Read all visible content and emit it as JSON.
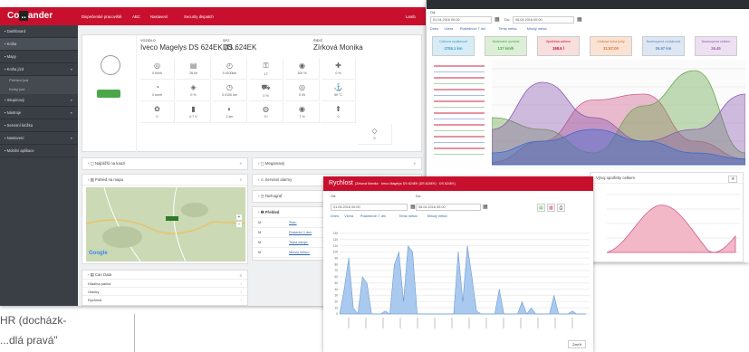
{
  "main": {
    "logo": {
      "pre": "Co",
      "accent": "..",
      "post": "ander",
      "tagline": ""
    },
    "nav": [
      "Dispečerské pracoviště",
      "ABC",
      "Nastavení",
      "Security dispatch"
    ],
    "nav_right": "Lamb",
    "sidebar": [
      {
        "label": "Dashboard",
        "icon": "dashboard-icon"
      },
      {
        "label": "Kniha",
        "icon": "book-icon",
        "active": true
      },
      {
        "label": "Mapy",
        "icon": "map-icon"
      },
      {
        "label": "Kniha jízd",
        "icon": "route-icon",
        "caret": true
      },
      {
        "label": "Přehled jízd",
        "sub": true
      },
      {
        "label": "Knihy jízd",
        "sub": true
      },
      {
        "label": "Skupinový",
        "icon": "group-icon",
        "caret": true
      },
      {
        "label": "Nástroje",
        "icon": "tools-icon",
        "caret": true
      },
      {
        "label": "Servisní knížka",
        "icon": "service-icon"
      },
      {
        "label": "Nastavení",
        "icon": "settings-icon",
        "caret": true
      },
      {
        "label": "Mobilní aplikace",
        "icon": "mobile-icon"
      }
    ],
    "vehicle": {
      "vehicle_label": "VOZIDLO",
      "vehicle_value": "Iveco Magelys DS 624EK (D...",
      "spz_label": "SPZ",
      "spz_value": "DS 624EK",
      "driver_label": "ŘIDIČ",
      "driver_value": "Zírková Monika",
      "cells": [
        {
          "icon": "◎",
          "v": "0 km/h"
        },
        {
          "icon": "▤",
          "v": "26 l/h"
        },
        {
          "icon": "◴",
          "v": "0 l/100km"
        },
        {
          "icon": "⚿",
          "v": "17"
        },
        {
          "icon": "◉",
          "v": "100 %"
        },
        {
          "icon": "✚",
          "v": "0 %"
        },
        {
          "icon": "◔",
          "v": "0 km/h"
        },
        {
          "icon": "◈",
          "v": "0 %"
        },
        {
          "icon": "◷",
          "v": "0 l/100 km"
        },
        {
          "icon": "⛟",
          "v": "0 %"
        },
        {
          "icon": "◎",
          "v": "0 l/h"
        },
        {
          "icon": "⚓",
          "v": "59 °C"
        },
        {
          "icon": "✿",
          "v": "0"
        },
        {
          "icon": "▮",
          "v": "0.7 V"
        },
        {
          "icon": "◐",
          "v": "1 km"
        },
        {
          "icon": "◍",
          "v": "0 l"
        },
        {
          "icon": "◉",
          "v": "7 %"
        },
        {
          "icon": "⬆",
          "v": "0"
        }
      ],
      "extra_icon": "◇",
      "extra_val": "0"
    },
    "panels": {
      "nearest": "Najbližší na kauzi",
      "megamap": "Megamaný",
      "map_panel": "Pohled na mapu",
      "alarms": "Servisní alarmy",
      "tacho": "Tachograf",
      "overview": "Přehled",
      "can": "Can Data"
    },
    "overview_rows": [
      {
        "a": "M",
        "b": "Stav:",
        "c": "38.7 km"
      },
      {
        "a": "M",
        "b": "Poslední 1 den",
        "c": "510.1 km"
      },
      {
        "a": "M",
        "b": "Teplá zdroje:",
        "c": "126.9 km"
      },
      {
        "a": "M",
        "b": "Minulý měsíc:",
        "c": "2750.1 km"
      }
    ],
    "can_rows": [
      "Hladina paliva",
      "Otáčky",
      "Rychlost"
    ],
    "map_google": "Google"
  },
  "win2": {
    "from_label": "Od:",
    "from_value": "01.04.2016 00:00",
    "to_label": "Do:",
    "to_value": "08.04.2016 00:00",
    "links": [
      "Dnes",
      "Včera",
      "Posledních 7 dní",
      "Tento měsíc",
      "Minulý měsíc"
    ],
    "stats": [
      {
        "label": "Celková vzdálenost",
        "value": "2755.1 km",
        "color": "#3a9bd0",
        "bg": "#d7ecf6"
      },
      {
        "label": "Maximální rychlost",
        "value": "137 km/h",
        "color": "#4aa84a",
        "bg": "#dcefd6"
      },
      {
        "label": "Spotřeba celkem",
        "value": "198.6 l",
        "color": "#c8102e",
        "bg": "#f9dede"
      },
      {
        "label": "Celková doba jízdy",
        "value": "31:57:00",
        "color": "#e06a2a",
        "bg": "#fbe3d4"
      },
      {
        "label": "Nastoupená vzdálenost",
        "value": "26.97 km",
        "color": "#5a8ac8",
        "bg": "#dde6f3"
      },
      {
        "label": "Nastoupená celkem",
        "value": "26.45",
        "color": "#9a5ab0",
        "bg": "#ece0f1"
      }
    ],
    "panel_title": "Vývoj spotřeby celkem",
    "chart_data": {
      "type": "area",
      "series": [
        {
          "color": "#d05a8a",
          "values": [
            2,
            20,
            55,
            60,
            20,
            5
          ]
        },
        {
          "color": "#6aa84a",
          "values": [
            40,
            30,
            10,
            50,
            80,
            10
          ]
        },
        {
          "color": "#8a5ab0",
          "values": [
            30,
            70,
            40,
            20,
            30,
            60
          ]
        },
        {
          "color": "#3a6ad0",
          "values": [
            10,
            20,
            30,
            20,
            10,
            5
          ]
        }
      ]
    }
  },
  "win3": {
    "title": "Rychlost",
    "subtitle": "(Zírková Monika · Iveco Magelys DS 624EK (DS 624EK) · DS 624EK)",
    "from_label": "Od:",
    "from_value": "01.04.2016 00:00",
    "to_label": "Do:",
    "to_value": "08.04.2016 00:00",
    "links": [
      "Dnes",
      "Včera",
      "Posledních 7 dní",
      "Tento měsíc",
      "Minulý měsíc"
    ],
    "close_label": "Zavřít",
    "chart_data": {
      "type": "area",
      "ylim": [
        0,
        140
      ],
      "yticks": [
        0,
        10,
        20,
        30,
        40,
        50,
        60,
        70,
        80,
        90,
        100,
        110,
        120,
        130
      ],
      "values": [
        0,
        40,
        90,
        10,
        0,
        60,
        50,
        0,
        0,
        0,
        5,
        0,
        80,
        100,
        20,
        110,
        100,
        0,
        0,
        0,
        0,
        0,
        0,
        0,
        0,
        0,
        100,
        20,
        110,
        60,
        5,
        0,
        0,
        0,
        0,
        40,
        0,
        0,
        0,
        0,
        20,
        0,
        10,
        0,
        0,
        0,
        0,
        30,
        0,
        0,
        0,
        5,
        0,
        0,
        0
      ]
    }
  },
  "doc": {
    "line1": "HR (docházk-",
    "line2": "...dlá pravá\""
  }
}
